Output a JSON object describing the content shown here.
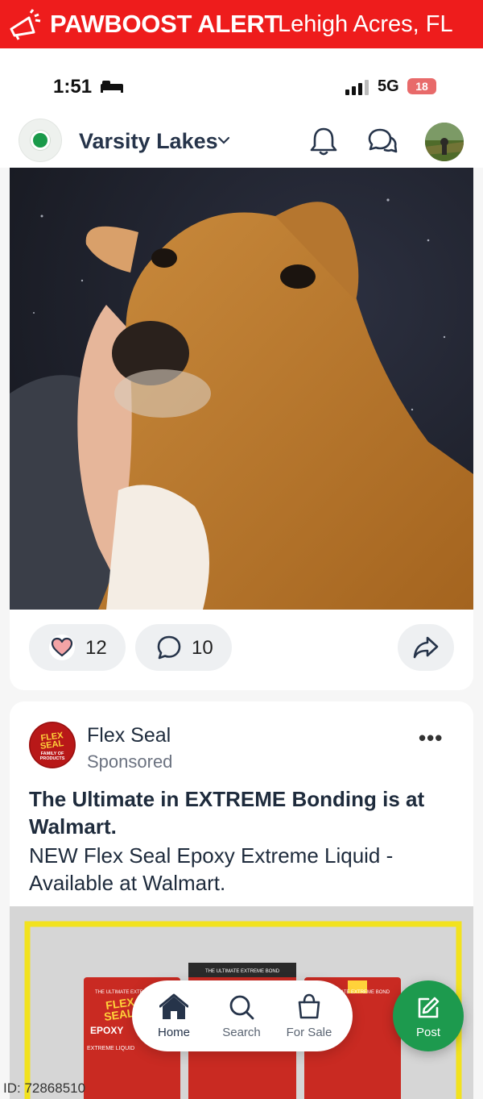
{
  "banner": {
    "brand": "PAWBOOST ALERT",
    "location": "Lehigh Acres, FL"
  },
  "status_bar": {
    "time": "1:51",
    "network": "5G",
    "battery": "18"
  },
  "header": {
    "neighborhood": "Varsity Lakes"
  },
  "post": {
    "likes": "12",
    "comments": "10"
  },
  "ad": {
    "advertiser": "Flex Seal",
    "sponsored": "Sponsored",
    "logo_lines": [
      "FLEX",
      "SEAL",
      "FAMILY OF",
      "PRODUCTS"
    ],
    "headline": "The Ultimate in EXTREME Bonding is at Walmart.",
    "body": "NEW Flex Seal Epoxy Extreme Liquid - Available at Walmart.",
    "product": {
      "brand_top": "FLEX",
      "brand_bottom": "SEAL",
      "name": "EPOXY",
      "caption": "EXTREME LIQUID",
      "tag": "THE ULTIMATE EXTREME BOND"
    }
  },
  "bottom_nav": {
    "home": "Home",
    "search": "Search",
    "for_sale": "For Sale",
    "post": "Post"
  },
  "footer_id": "ID: 72868510",
  "colors": {
    "banner_red": "#ee1c1c",
    "nextdoor_green": "#1d9a4e",
    "flexseal_red": "#b81818"
  }
}
